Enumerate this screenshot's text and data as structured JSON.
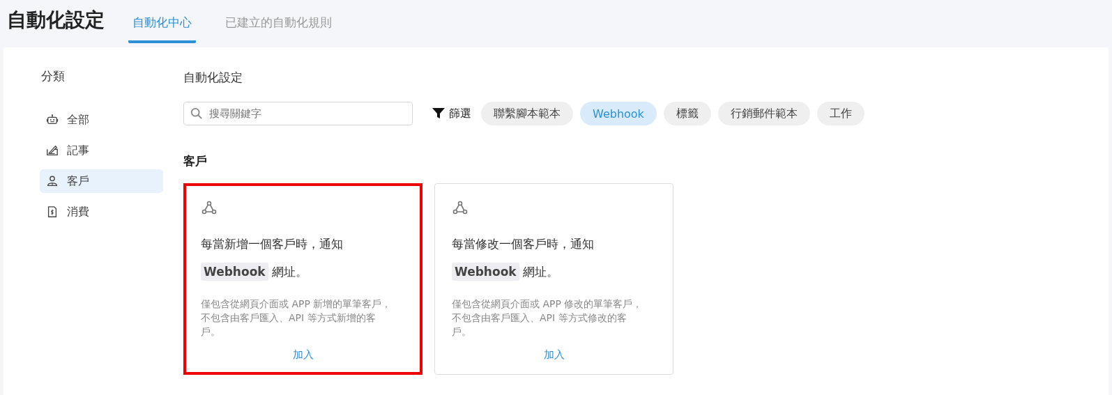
{
  "header": {
    "title": "自動化設定",
    "tabs": [
      {
        "label": "自動化中心",
        "selected": true
      },
      {
        "label": "已建立的自動化規則",
        "selected": false
      }
    ]
  },
  "sidebar": {
    "heading": "分類",
    "items": [
      {
        "label": "全部",
        "kind": "robot",
        "selected": false
      },
      {
        "label": "記事",
        "kind": "note",
        "selected": false
      },
      {
        "label": "客戶",
        "kind": "person",
        "selected": true
      },
      {
        "label": "消費",
        "kind": "receipt",
        "selected": false
      }
    ]
  },
  "content": {
    "title": "自動化設定",
    "search": {
      "placeholder": "搜尋關鍵字"
    },
    "filter_label": "篩選",
    "chips": [
      {
        "label": "聯繫腳本範本",
        "selected": false
      },
      {
        "label": "Webhook",
        "selected": true
      },
      {
        "label": "標籤",
        "selected": false
      },
      {
        "label": "行銷郵件範本",
        "selected": false
      },
      {
        "label": "工作",
        "selected": false
      }
    ],
    "section": "客戶",
    "cards": [
      {
        "title": "每當新增一個客戶時，通知 **Webhook** 網址。",
        "description": "僅包含從網頁介面或 APP 新增的單筆客戶，不包含由客戶匯入、API 等方式新增的客戶。",
        "action": "加入",
        "highlighted": true
      },
      {
        "title": "每當修改一個客戶時，通知 **Webhook** 網址。",
        "description": "僅包含從網頁介面或 APP 修改的單筆客戶，不包含由客戶匯入、API 等方式修改的客戶。",
        "action": "加入",
        "highlighted": false
      }
    ]
  }
}
